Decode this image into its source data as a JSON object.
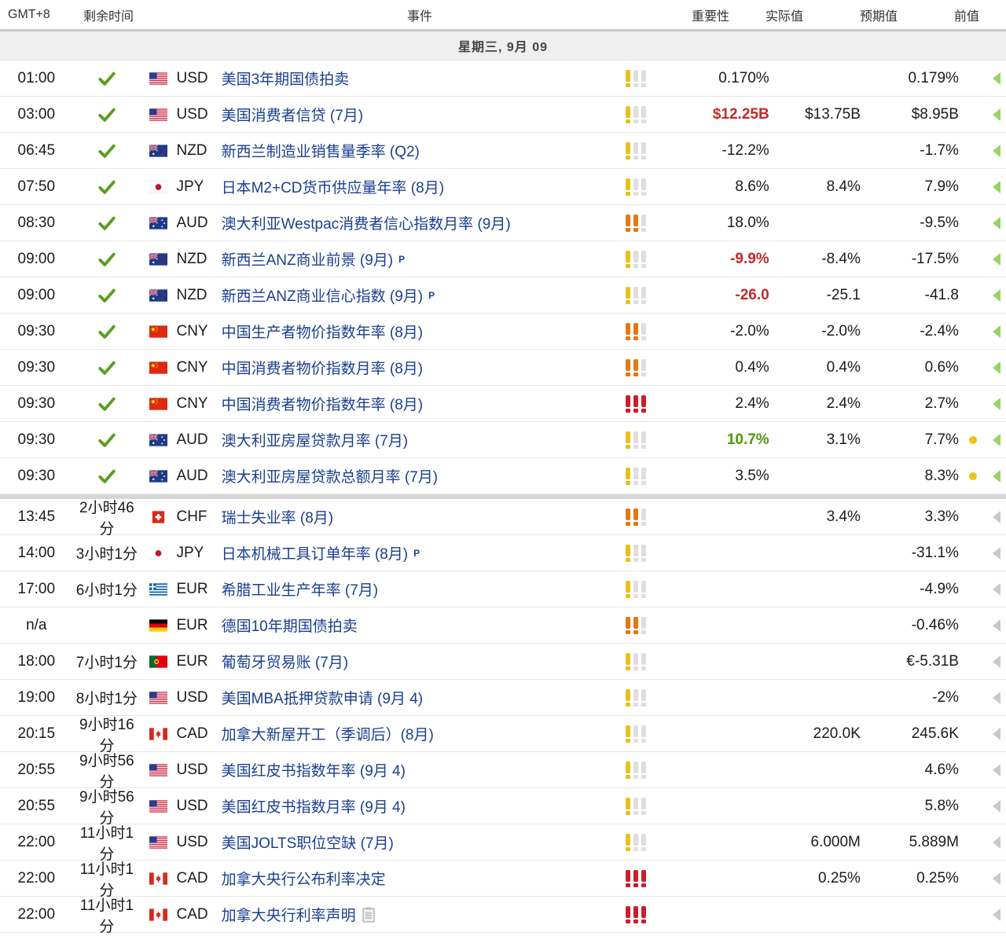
{
  "header": {
    "timezone": "GMT+8",
    "remaining": "剩余时间",
    "event": "事件",
    "importance": "重要性",
    "actual": "实际值",
    "forecast": "预期值",
    "previous": "前值"
  },
  "date_label": "星期三, 9月 09",
  "colors": {
    "event_link": "#1a3f8f",
    "actual_red": "#c62828",
    "actual_green": "#4e9a06",
    "importance_active": "#e8c018",
    "importance_high": "#c81f2a",
    "importance_inactive": "#dedede",
    "check_green": "#5a9e1d"
  },
  "past_rows": [
    {
      "time": "01:00",
      "remaining": "check",
      "flag": "us",
      "currency": "USD",
      "event": "美国3年期国债拍卖",
      "p": false,
      "importance": 1,
      "actual": "0.170%",
      "actual_color": "",
      "forecast": "",
      "previous": "0.179%",
      "dot": false
    },
    {
      "time": "03:00",
      "remaining": "check",
      "flag": "us",
      "currency": "USD",
      "event": "美国消费者信贷 (7月)",
      "p": false,
      "importance": 1,
      "actual": "$12.25B",
      "actual_color": "red",
      "forecast": "$13.75B",
      "previous": "$8.95B",
      "dot": false
    },
    {
      "time": "06:45",
      "remaining": "check",
      "flag": "nz",
      "currency": "NZD",
      "event": "新西兰制造业销售量季率 (Q2)",
      "p": false,
      "importance": 1,
      "actual": "-12.2%",
      "actual_color": "",
      "forecast": "",
      "previous": "-1.7%",
      "dot": false
    },
    {
      "time": "07:50",
      "remaining": "check",
      "flag": "jp",
      "currency": "JPY",
      "event": "日本M2+CD货币供应量年率 (8月)",
      "p": false,
      "importance": 1,
      "actual": "8.6%",
      "actual_color": "",
      "forecast": "8.4%",
      "previous": "7.9%",
      "dot": false
    },
    {
      "time": "08:30",
      "remaining": "check",
      "flag": "au",
      "currency": "AUD",
      "event": "澳大利亚Westpac消费者信心指数月率 (9月)",
      "p": false,
      "importance": 2,
      "actual": "18.0%",
      "actual_color": "",
      "forecast": "",
      "previous": "-9.5%",
      "dot": false
    },
    {
      "time": "09:00",
      "remaining": "check",
      "flag": "nz",
      "currency": "NZD",
      "event": "新西兰ANZ商业前景 (9月)",
      "p": true,
      "importance": 1,
      "actual": "-9.9%",
      "actual_color": "red",
      "forecast": "-8.4%",
      "previous": "-17.5%",
      "dot": false
    },
    {
      "time": "09:00",
      "remaining": "check",
      "flag": "nz",
      "currency": "NZD",
      "event": "新西兰ANZ商业信心指数 (9月)",
      "p": true,
      "importance": 1,
      "actual": "-26.0",
      "actual_color": "red",
      "forecast": "-25.1",
      "previous": "-41.8",
      "dot": false
    },
    {
      "time": "09:30",
      "remaining": "check",
      "flag": "cn",
      "currency": "CNY",
      "event": "中国生产者物价指数年率 (8月)",
      "p": false,
      "importance": 2,
      "actual": "-2.0%",
      "actual_color": "",
      "forecast": "-2.0%",
      "previous": "-2.4%",
      "dot": false
    },
    {
      "time": "09:30",
      "remaining": "check",
      "flag": "cn",
      "currency": "CNY",
      "event": "中国消费者物价指数月率 (8月)",
      "p": false,
      "importance": 2,
      "actual": "0.4%",
      "actual_color": "",
      "forecast": "0.4%",
      "previous": "0.6%",
      "dot": false
    },
    {
      "time": "09:30",
      "remaining": "check",
      "flag": "cn",
      "currency": "CNY",
      "event": "中国消费者物价指数年率 (8月)",
      "p": false,
      "importance": 3,
      "actual": "2.4%",
      "actual_color": "",
      "forecast": "2.4%",
      "previous": "2.7%",
      "dot": false
    },
    {
      "time": "09:30",
      "remaining": "check",
      "flag": "au",
      "currency": "AUD",
      "event": "澳大利亚房屋贷款月率 (7月)",
      "p": false,
      "importance": 1,
      "actual": "10.7%",
      "actual_color": "green",
      "forecast": "3.1%",
      "previous": "7.7%",
      "dot": true
    },
    {
      "time": "09:30",
      "remaining": "check",
      "flag": "au",
      "currency": "AUD",
      "event": "澳大利亚房屋贷款总额月率 (7月)",
      "p": false,
      "importance": 1,
      "actual": "3.5%",
      "actual_color": "",
      "forecast": "",
      "previous": "8.3%",
      "dot": true
    }
  ],
  "upcoming_rows": [
    {
      "time": "13:45",
      "remaining": "2小时46分",
      "flag": "ch",
      "currency": "CHF",
      "event": "瑞士失业率 (8月)",
      "p": false,
      "doc": false,
      "importance": 2,
      "actual": "",
      "actual_color": "",
      "forecast": "3.4%",
      "previous": "3.3%"
    },
    {
      "time": "14:00",
      "remaining": "3小时1分",
      "flag": "jp",
      "currency": "JPY",
      "event": "日本机械工具订单年率 (8月)",
      "p": true,
      "doc": false,
      "importance": 1,
      "actual": "",
      "actual_color": "",
      "forecast": "",
      "previous": "-31.1%"
    },
    {
      "time": "17:00",
      "remaining": "6小时1分",
      "flag": "gr",
      "currency": "EUR",
      "event": "希腊工业生产年率 (7月)",
      "p": false,
      "doc": false,
      "importance": 1,
      "actual": "",
      "actual_color": "",
      "forecast": "",
      "previous": "-4.9%"
    },
    {
      "time": "n/a",
      "remaining": "",
      "flag": "de",
      "currency": "EUR",
      "event": "德国10年期国债拍卖",
      "p": false,
      "doc": false,
      "importance": 2,
      "actual": "",
      "actual_color": "",
      "forecast": "",
      "previous": "-0.46%"
    },
    {
      "time": "18:00",
      "remaining": "7小时1分",
      "flag": "pt",
      "currency": "EUR",
      "event": "葡萄牙贸易账 (7月)",
      "p": false,
      "doc": false,
      "importance": 1,
      "actual": "",
      "actual_color": "",
      "forecast": "",
      "previous": "€-5.31B"
    },
    {
      "time": "19:00",
      "remaining": "8小时1分",
      "flag": "us",
      "currency": "USD",
      "event": "美国MBA抵押贷款申请 (9月 4)",
      "p": false,
      "doc": false,
      "importance": 1,
      "actual": "",
      "actual_color": "",
      "forecast": "",
      "previous": "-2%"
    },
    {
      "time": "20:15",
      "remaining": "9小时16分",
      "flag": "ca",
      "currency": "CAD",
      "event": "加拿大新屋开工（季调后）(8月)",
      "p": false,
      "doc": false,
      "importance": 1,
      "actual": "",
      "actual_color": "",
      "forecast": "220.0K",
      "previous": "245.6K"
    },
    {
      "time": "20:55",
      "remaining": "9小时56分",
      "flag": "us",
      "currency": "USD",
      "event": "美国红皮书指数年率 (9月 4)",
      "p": false,
      "doc": false,
      "importance": 1,
      "actual": "",
      "actual_color": "",
      "forecast": "",
      "previous": "4.6%"
    },
    {
      "time": "20:55",
      "remaining": "9小时56分",
      "flag": "us",
      "currency": "USD",
      "event": "美国红皮书指数月率 (9月 4)",
      "p": false,
      "doc": false,
      "importance": 1,
      "actual": "",
      "actual_color": "",
      "forecast": "",
      "previous": "5.8%"
    },
    {
      "time": "22:00",
      "remaining": "11小时1分",
      "flag": "us",
      "currency": "USD",
      "event": "美国JOLTS职位空缺 (7月)",
      "p": false,
      "doc": false,
      "importance": 1,
      "actual": "",
      "actual_color": "",
      "forecast": "6.000M",
      "previous": "5.889M"
    },
    {
      "time": "22:00",
      "remaining": "11小时1分",
      "flag": "ca",
      "currency": "CAD",
      "event": "加拿大央行公布利率决定",
      "p": false,
      "doc": false,
      "importance": 3,
      "actual": "",
      "actual_color": "",
      "forecast": "0.25%",
      "previous": "0.25%"
    },
    {
      "time": "22:00",
      "remaining": "11小时1分",
      "flag": "ca",
      "currency": "CAD",
      "event": "加拿大央行利率声明",
      "p": false,
      "doc": true,
      "importance": 3,
      "actual": "",
      "actual_color": "",
      "forecast": "",
      "previous": ""
    }
  ],
  "p_tag": "P"
}
